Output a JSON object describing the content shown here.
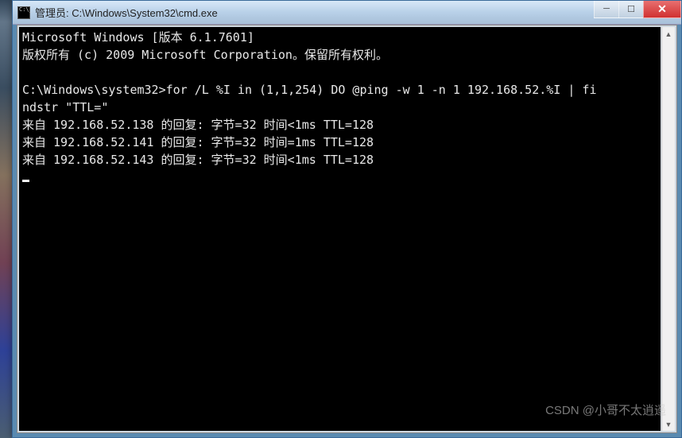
{
  "window": {
    "title": "管理员: C:\\Windows\\System32\\cmd.exe"
  },
  "controls": {
    "minimize": "─",
    "maximize": "☐",
    "close": "✕"
  },
  "scrollbar": {
    "up": "▲",
    "down": "▼"
  },
  "console": {
    "header1": "Microsoft Windows [版本 6.1.7601]",
    "header2": "版权所有 (c) 2009 Microsoft Corporation。保留所有权利。",
    "prompt": "C:\\Windows\\system32>",
    "command": "for /L %I in (1,1,254) DO @ping -w 1 -n 1 192.168.52.%I | findstr \"TTL=\"",
    "replies": [
      "来自 192.168.52.138 的回复: 字节=32 时间<1ms TTL=128",
      "来自 192.168.52.141 的回复: 字节=32 时间=1ms TTL=128",
      "来自 192.168.52.143 的回复: 字节=32 时间<1ms TTL=128"
    ]
  },
  "watermark": "CSDN @小哥不太逍遥"
}
